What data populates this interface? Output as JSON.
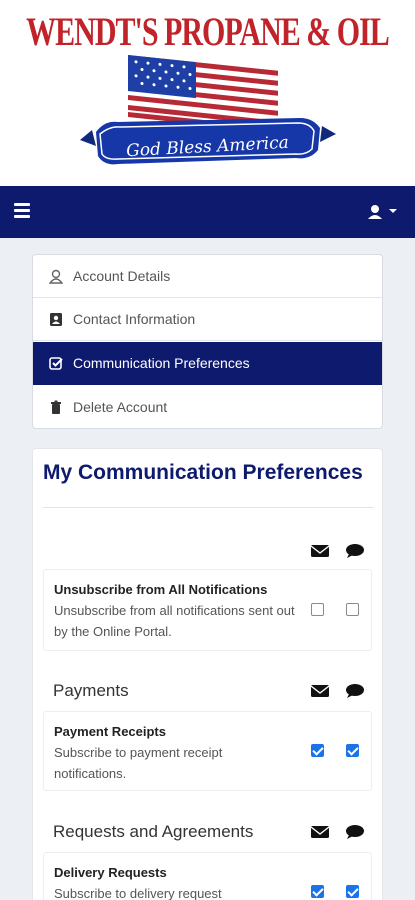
{
  "brand": {
    "name": "WENDT'S PROPANE & OIL",
    "tagline": "God Bless America"
  },
  "navbar": {
    "menu_icon": "hamburger-menu-icon",
    "user_icon": "user-icon",
    "dropdown_icon": "caret-down-icon",
    "color": "#0e1a6e"
  },
  "sidebar": {
    "items": [
      {
        "label": "Account Details",
        "icon": "user-outline-icon",
        "active": false
      },
      {
        "label": "Contact Information",
        "icon": "contact-card-icon",
        "active": false
      },
      {
        "label": "Communication Preferences",
        "icon": "checkbox-icon",
        "active": true
      },
      {
        "label": "Delete Account",
        "icon": "trash-icon",
        "active": false
      }
    ]
  },
  "main": {
    "title": "My Communication Preferences",
    "column_icons": [
      "envelope-icon",
      "chat-bubble-icon"
    ],
    "sections": [
      {
        "title": "",
        "prefs": [
          {
            "title": "Unsubscribe from All Notifications",
            "desc": "Unsubscribe from all notifications sent out by the Online Portal.",
            "email": false,
            "text": false
          }
        ]
      },
      {
        "title": "Payments",
        "prefs": [
          {
            "title": "Payment Receipts",
            "desc": "Subscribe to payment receipt notifications.",
            "email": true,
            "text": true
          }
        ]
      },
      {
        "title": "Requests and Agreements",
        "prefs": [
          {
            "title": "Delivery Requests",
            "desc": "Subscribe to delivery request",
            "email": true,
            "text": true
          }
        ]
      }
    ]
  },
  "colors": {
    "brand_red": "#c0242a",
    "navy": "#0e1a6e",
    "checkbox_blue": "#1a73e8"
  }
}
